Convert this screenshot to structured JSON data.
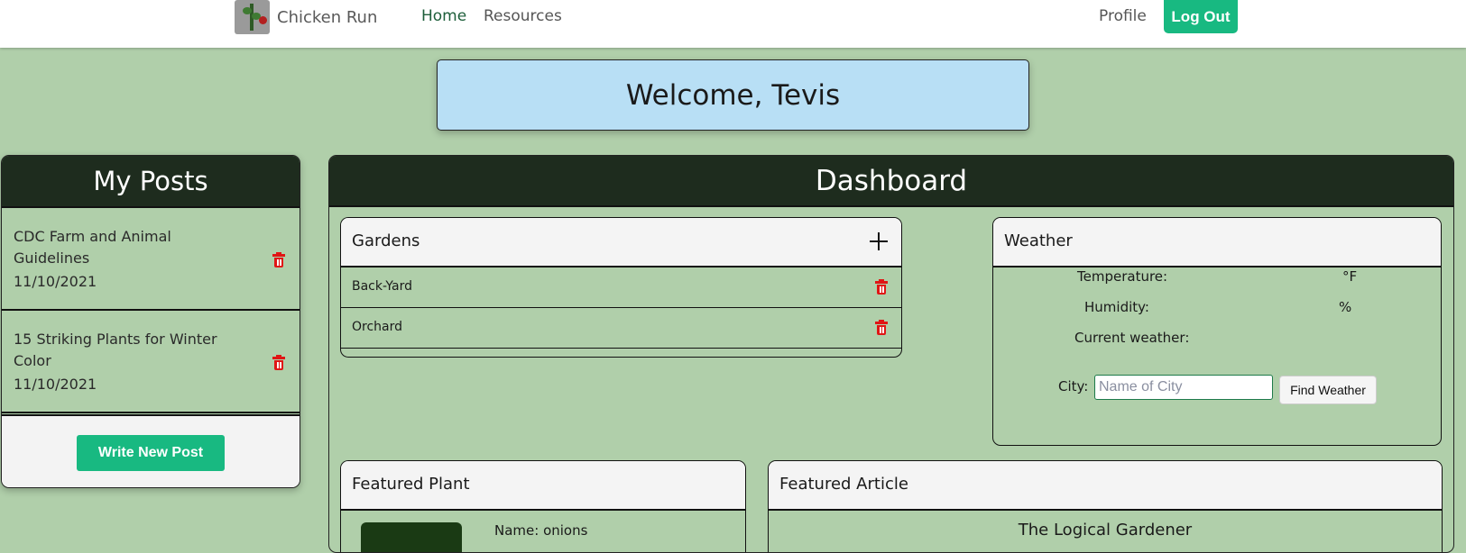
{
  "nav": {
    "brand": "Chicken Run",
    "home": "Home",
    "resources": "Resources",
    "profile": "Profile",
    "logout": "Log Out"
  },
  "welcome": "Welcome, Tevis",
  "posts": {
    "title": "My Posts",
    "items": [
      {
        "title": "CDC Farm and Animal Guidelines",
        "date": "11/10/2021"
      },
      {
        "title": "15 Striking Plants for Winter Color",
        "date": "11/10/2021"
      }
    ],
    "write_label": "Write New Post"
  },
  "dashboard": {
    "title": "Dashboard",
    "gardens": {
      "title": "Gardens",
      "items": [
        "Back-Yard",
        "Orchard"
      ]
    },
    "weather": {
      "title": "Weather",
      "temperature_label": "Temperature:",
      "temperature_unit": "°F",
      "humidity_label": "Humidity:",
      "humidity_unit": "%",
      "current_label": "Current weather:",
      "city_label": "City:",
      "city_placeholder": "Name of City",
      "find_label": "Find Weather"
    },
    "featured_plant": {
      "title": "Featured Plant",
      "name": "Name: onions"
    },
    "featured_article": {
      "title": "Featured Article",
      "article_title": "The Logical Gardener"
    }
  },
  "colors": {
    "background": "#b0cfaa",
    "header_dark": "#1e2c1e",
    "accent_green": "#18b981",
    "welcome_blue": "#b8dff5",
    "trash_red": "#e01515"
  }
}
